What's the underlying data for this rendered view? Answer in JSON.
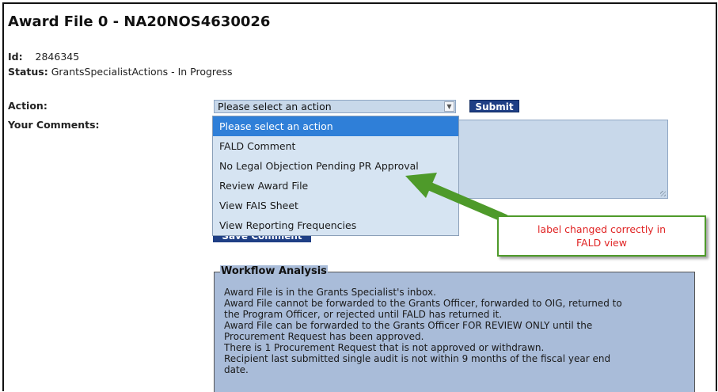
{
  "header": {
    "title": "Award File 0 - NA20NOS4630026"
  },
  "meta": {
    "id_label": "Id:",
    "id_value": "2846345",
    "status_label": "Status:",
    "status_value": "GrantsSpecialistActions - In Progress"
  },
  "form": {
    "action_label": "Action:",
    "comments_label": "Your Comments:",
    "select_value": "Please select an action",
    "submit_label": "Submit",
    "save_comment_label": "Save Comment",
    "options": [
      "Please select an action",
      "FALD Comment",
      "No Legal Objection Pending PR Approval",
      "Review Award File",
      "View FAIS Sheet",
      "View Reporting Frequencies"
    ]
  },
  "callout": {
    "text": "label changed correctly in FALD view"
  },
  "workflow": {
    "legend": "Workflow Analysis",
    "lines": [
      "Award File is in the Grants Specialist's inbox.",
      "Award File cannot be forwarded to the Grants Officer, forwarded to OIG, returned to",
      "the Program Officer, or rejected until FALD has returned it.",
      "Award File can be forwarded to the Grants Officer FOR REVIEW ONLY until the",
      "Procurement Request has been approved.",
      "There is 1 Procurement Request that is not approved or withdrawn.",
      "Recipient last submitted single audit is not within 9 months of the fiscal year end",
      "date."
    ]
  },
  "colors": {
    "field_bg": "#c8d8ea",
    "button_bg": "#1f3f85",
    "selected_option": "#2f7fd8",
    "callout_border": "#4e9a2a",
    "callout_text": "#e02424",
    "workflow_bg": "#a9bcd9"
  },
  "icons": {
    "dropdown": "chevron-down-icon",
    "resize": "resize-grip-icon",
    "pointer": "green-arrow-icon"
  }
}
